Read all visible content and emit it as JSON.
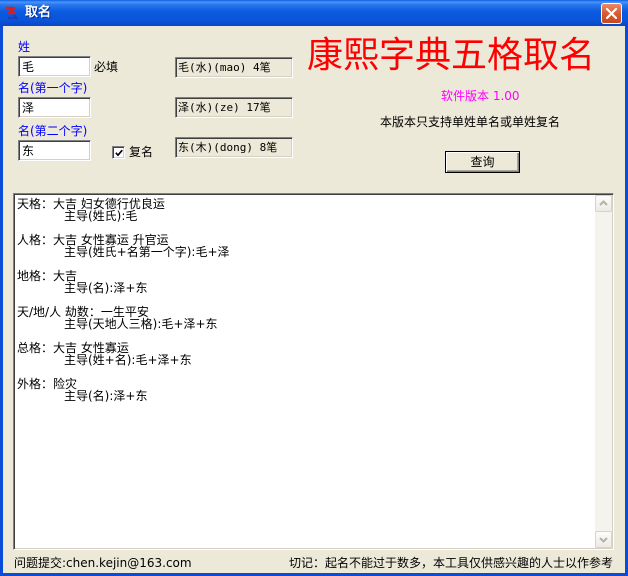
{
  "window": {
    "title": "取名"
  },
  "icons": {
    "app": "app-icon",
    "close": "close-icon",
    "check": "check-icon",
    "scroll_up": "scroll-up-arrow-icon",
    "scroll_down": "scroll-down-arrow-icon"
  },
  "form": {
    "surname": {
      "label": "姓",
      "value": "毛",
      "required_note": "必填"
    },
    "given_first": {
      "label": "名(第一个字)",
      "value": "泽"
    },
    "given_second": {
      "label": "名(第二个字)",
      "value": "东"
    },
    "double_name": {
      "label": "复名",
      "checked": true
    }
  },
  "char_info": {
    "surname": "毛(水)(mao) 4笔",
    "given_first": "泽(水)(ze) 17笔",
    "given_second": "东(木)(dong) 8笔"
  },
  "header": {
    "title": "康熙字典五格取名",
    "version": "软件版本 1.00",
    "notice": "本版本只支持单姓单名或单姓复名"
  },
  "query_button": {
    "label": "查询"
  },
  "results": [
    {
      "heading": "天格：大吉 妇女德行优良运",
      "detail": "主导(姓氏):毛"
    },
    {
      "heading": "人格：大吉 女性寡运 升官运",
      "detail": "主导(姓氏+名第一个字):毛+泽"
    },
    {
      "heading": "地格：大吉",
      "detail": "主导(名):泽+东"
    },
    {
      "heading": "天/地/人 劫数：一生平安",
      "detail": "主导(天地人三格):毛+泽+东"
    },
    {
      "heading": "总格：大吉 女性寡运",
      "detail": "主导(姓+名):毛+泽+东"
    },
    {
      "heading": "外格：险灾",
      "detail": "主导(名):泽+东"
    }
  ],
  "footer": {
    "contact": "问题提交:chen.kejin@163.com",
    "disclaimer": "切记：起名不能过于数多，本工具仅供感兴趣的人士以作参考"
  },
  "colors": {
    "label": "#0000FF",
    "title": "#FF0000",
    "version": "#FF00FF"
  }
}
